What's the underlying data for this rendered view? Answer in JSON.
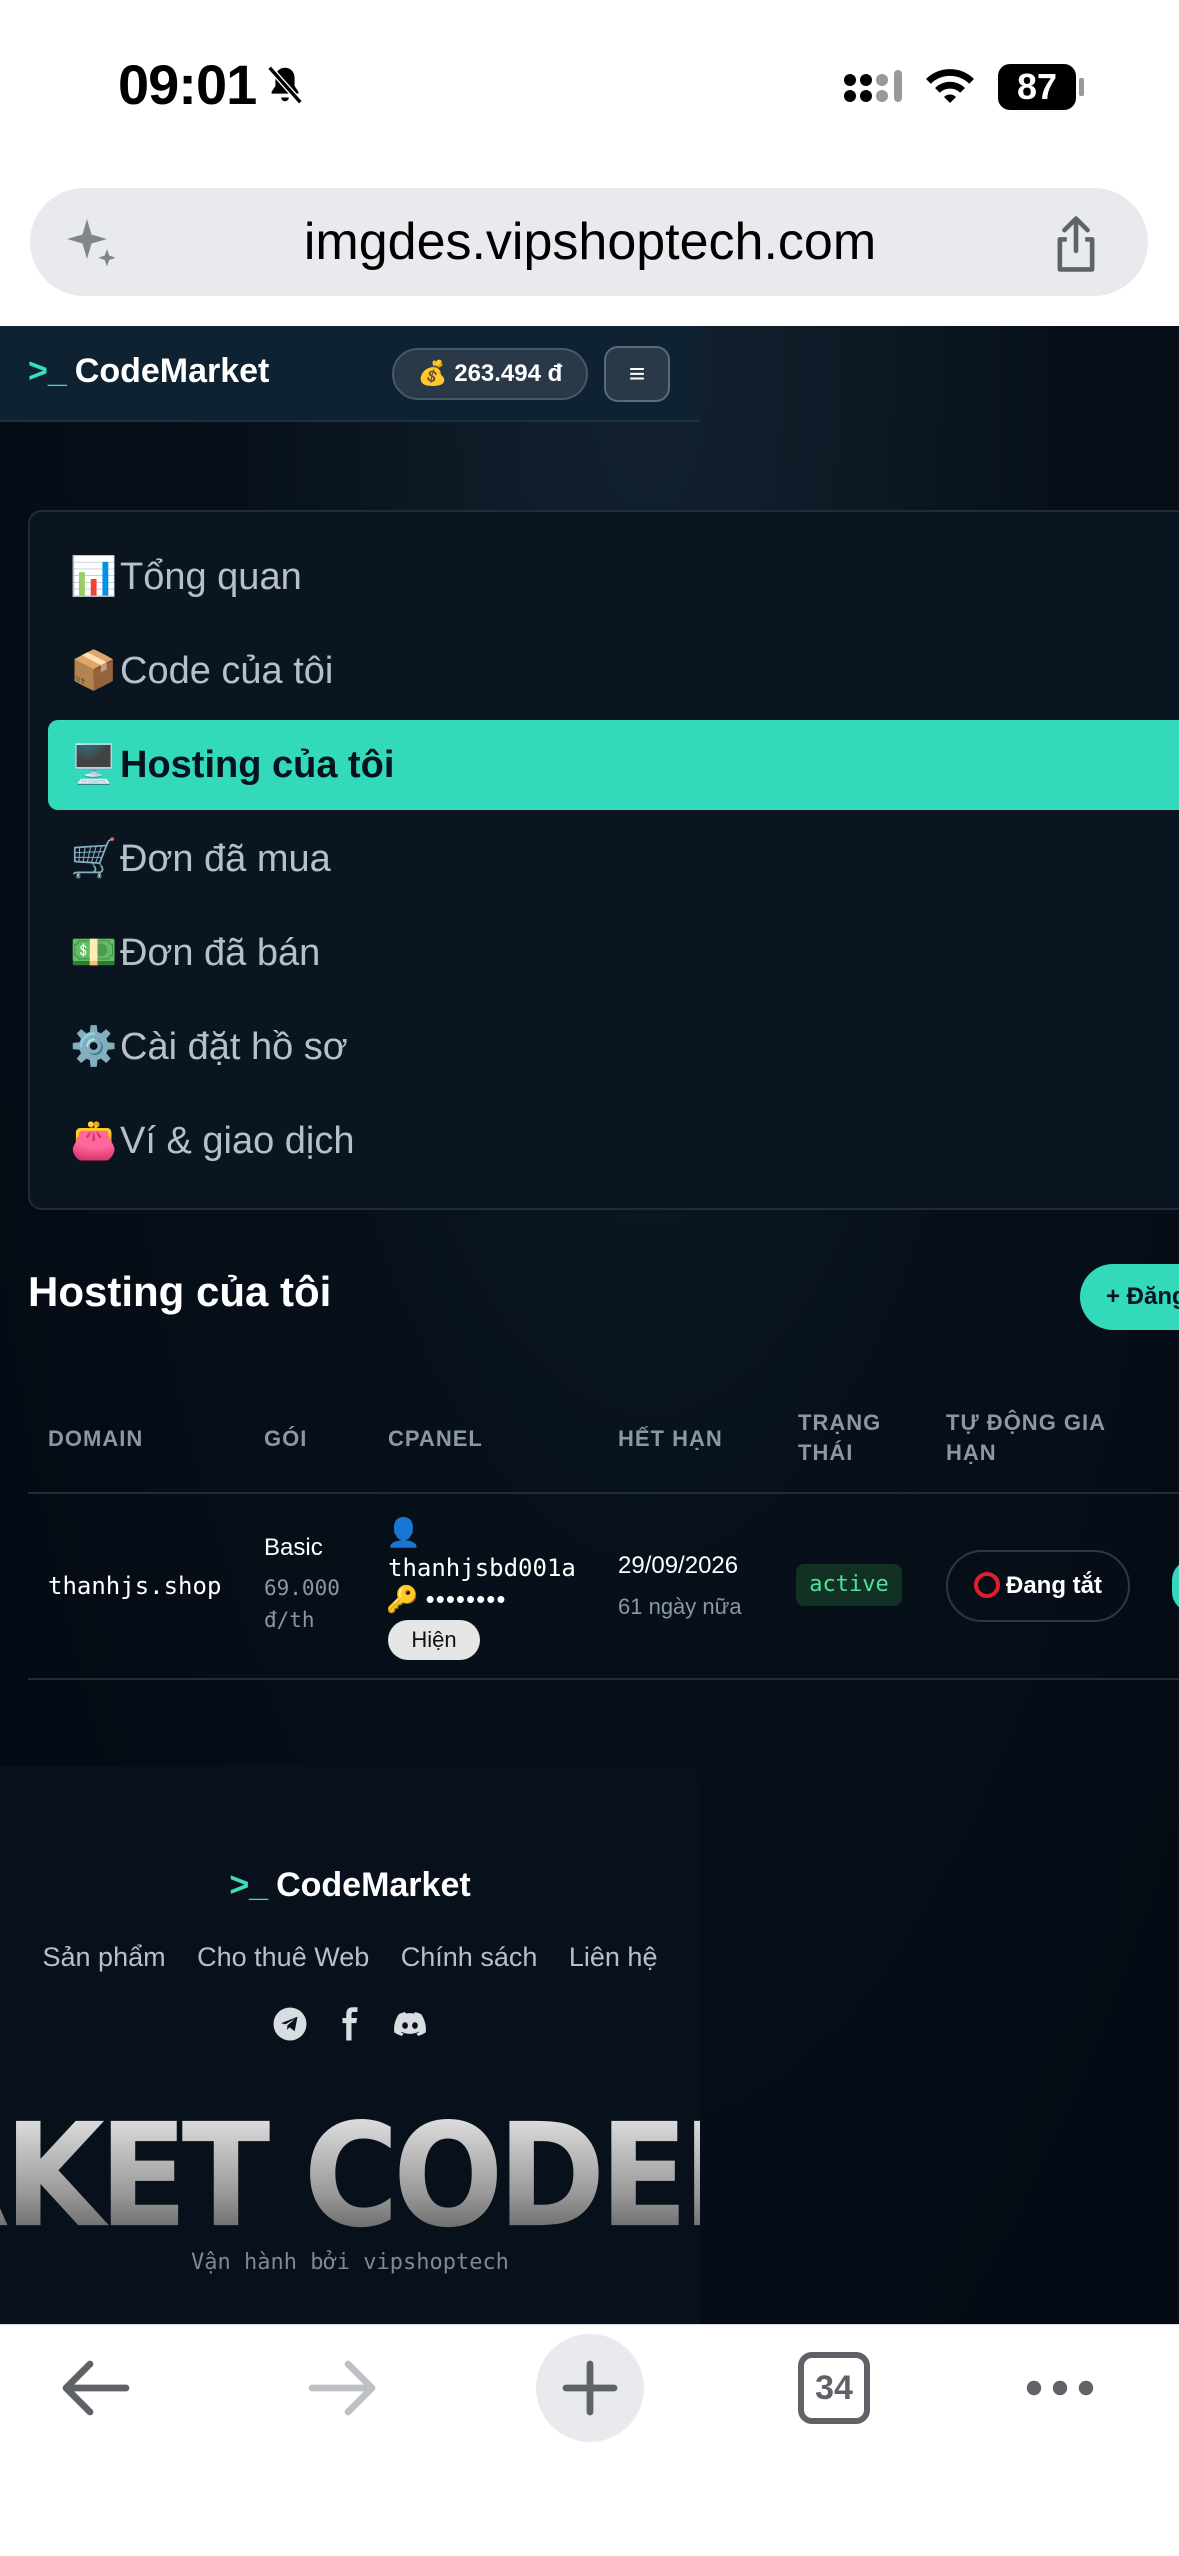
{
  "status_bar": {
    "time": "09:01",
    "battery": "87"
  },
  "browser": {
    "url": "imgdes.vipshoptech.com",
    "tab_count": "34"
  },
  "header": {
    "logo_prompt": ">_",
    "logo_text": "CodeMarket",
    "balance": "💰 263.494 đ",
    "menu_icon": "≡"
  },
  "nav": {
    "items": [
      {
        "emoji": "📊",
        "label": "Tổng quan"
      },
      {
        "emoji": "📦",
        "label": "Code của tôi"
      },
      {
        "emoji": "🖥️",
        "label": "Hosting của tôi"
      },
      {
        "emoji": "🛒",
        "label": "Đơn đã mua"
      },
      {
        "emoji": "💵",
        "label": "Đơn đã bán"
      },
      {
        "emoji": "⚙️",
        "label": "Cài đặt hồ sơ"
      },
      {
        "emoji": "👛",
        "label": "Ví & giao dịch"
      }
    ]
  },
  "section": {
    "title": "Hosting của tôi",
    "add_button": "+ Đăng"
  },
  "table": {
    "headers": {
      "domain": "DOMAIN",
      "plan": "GÓI",
      "cpanel": "CPANEL",
      "expiry": "HẾT HẠN",
      "status_1": "TRẠNG",
      "status_2": "THÁI",
      "auto_1": "TỰ ĐỘNG GIA",
      "auto_2": "HẠN"
    },
    "rows": [
      {
        "domain": "thanhjs.shop",
        "plan": "Basic",
        "price_1": "69.000",
        "price_2": "đ/th",
        "user_icon": "👤",
        "username": "thanhjsbd001a",
        "key_icon": "🔑",
        "password_mask": "••••••••",
        "show_label": "Hiện",
        "expiry_date": "29/09/2026",
        "expiry_left": "61 ngày nữa",
        "status": "active",
        "auto_renew": "Đang tắt"
      }
    ]
  },
  "footer": {
    "logo_prompt": ">_",
    "logo_text": "CodeMarket",
    "links": [
      "Sản phẩm",
      "Cho thuê Web",
      "Chính sách",
      "Liên hệ"
    ],
    "marquee": "RKET   CODEMARK",
    "operated_by": "Vận hành bởi vipshoptech"
  }
}
